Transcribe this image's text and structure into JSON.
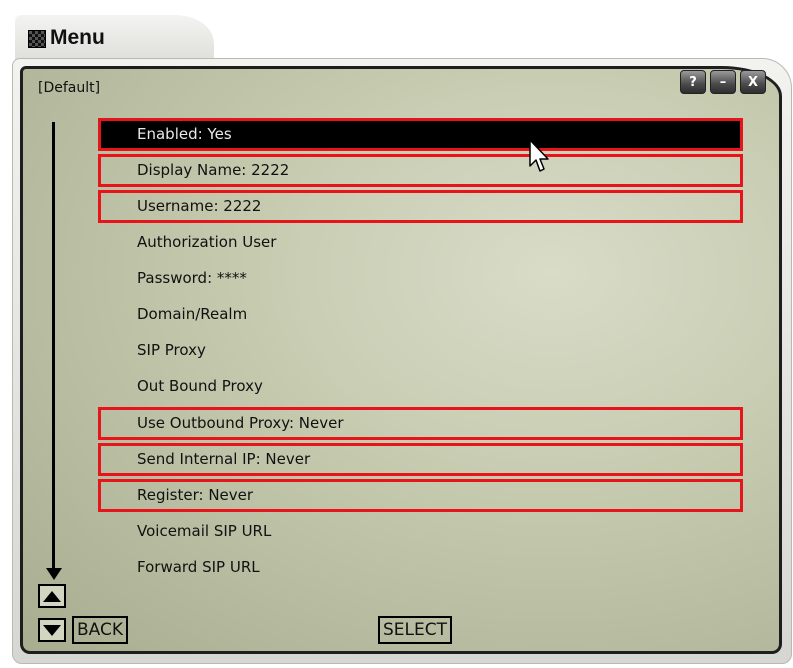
{
  "window": {
    "title": "Menu",
    "profile": "[Default]",
    "buttons": {
      "help": "?",
      "minimize": "–",
      "close": "X"
    }
  },
  "menu": {
    "items": [
      {
        "label": "Enabled: Yes",
        "outlined": true,
        "selected": true
      },
      {
        "label": "Display Name: 2222",
        "outlined": true,
        "selected": false
      },
      {
        "label": "Username: 2222",
        "outlined": true,
        "selected": false
      },
      {
        "label": "Authorization User",
        "outlined": false,
        "selected": false
      },
      {
        "label": "Password: ****",
        "outlined": false,
        "selected": false
      },
      {
        "label": "Domain/Realm",
        "outlined": false,
        "selected": false
      },
      {
        "label": "SIP Proxy",
        "outlined": false,
        "selected": false
      },
      {
        "label": "Out Bound Proxy",
        "outlined": false,
        "selected": false
      },
      {
        "label": "Use Outbound Proxy: Never",
        "outlined": true,
        "selected": false
      },
      {
        "label": "Send Internal IP: Never",
        "outlined": true,
        "selected": false
      },
      {
        "label": "Register: Never",
        "outlined": true,
        "selected": false
      },
      {
        "label": "Voicemail SIP URL",
        "outlined": false,
        "selected": false
      },
      {
        "label": "Forward SIP URL",
        "outlined": false,
        "selected": false
      }
    ]
  },
  "softkeys": {
    "back": "BACK",
    "select": "SELECT"
  },
  "colors": {
    "outline": "#e8141c",
    "selected_bg": "#000000",
    "screen": "#c6cbb0"
  },
  "icons": {
    "title": "menu-grid-icon",
    "scroll": "scroll-down-arrow-icon",
    "up": "arrow-up-icon",
    "down": "arrow-down-icon",
    "cursor": "mouse-pointer-icon"
  }
}
